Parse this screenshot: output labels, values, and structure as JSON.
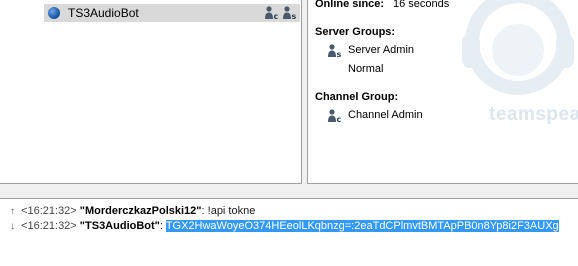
{
  "tree": {
    "client_name": "TS3AudioBot"
  },
  "info": {
    "online_since_label": "Online since:",
    "online_since_value": "16 seconds",
    "server_groups_label": "Server Groups:",
    "server_groups": [
      "Server Admin",
      "Normal"
    ],
    "channel_group_label": "Channel Group:",
    "channel_group": "Channel Admin",
    "watermark": "teamspeak"
  },
  "chat": {
    "messages": [
      {
        "direction": "incoming",
        "timestamp": "<16:21:32>",
        "nick": "\"MorderczkazPolski12\"",
        "separator": ":",
        "text": "!api tokne"
      },
      {
        "direction": "outgoing",
        "timestamp": "<16:21:32>",
        "nick": "\"TS3AudioBot\"",
        "separator": ":",
        "text": "TGX2HwaWoyeO374HEeolLKqbnzg=:2eaTdCPlmvtBMTApPB0n8Yp8i2F3AUXg"
      }
    ]
  },
  "colors": {
    "selection": "#3399ff",
    "row_highlight": "#d9d9d9",
    "watermark": "#dde6ee"
  }
}
